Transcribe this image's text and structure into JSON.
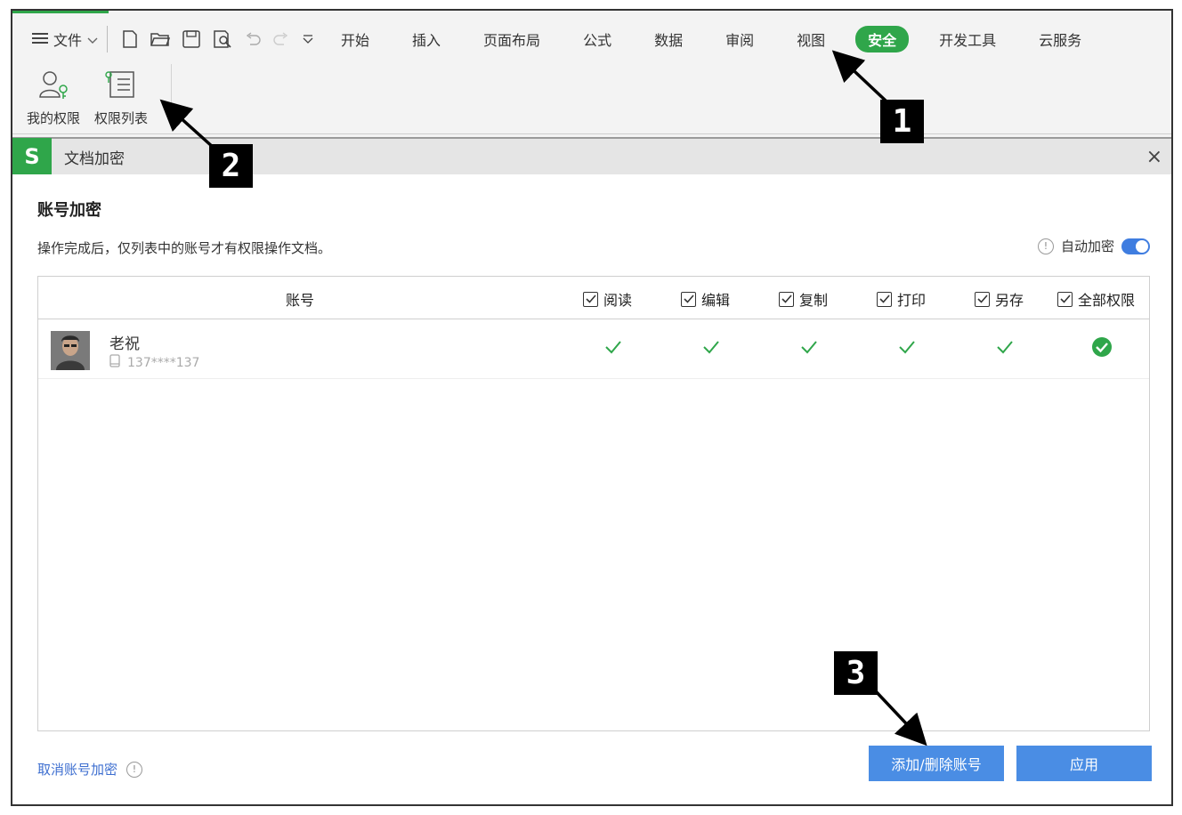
{
  "menu": {
    "file_label": "文件",
    "tabs": [
      {
        "label": "开始",
        "active": false
      },
      {
        "label": "插入",
        "active": false
      },
      {
        "label": "页面布局",
        "active": false
      },
      {
        "label": "公式",
        "active": false
      },
      {
        "label": "数据",
        "active": false
      },
      {
        "label": "审阅",
        "active": false
      },
      {
        "label": "视图",
        "active": false
      },
      {
        "label": "安全",
        "active": true
      },
      {
        "label": "开发工具",
        "active": false
      },
      {
        "label": "云服务",
        "active": false
      }
    ]
  },
  "tools": {
    "my_permission": "我的权限",
    "permission_list": "权限列表"
  },
  "dialog": {
    "logo": "S",
    "title": "文档加密",
    "close": "×",
    "section_title": "账号加密",
    "description": "操作完成后，仅列表中的账号才有权限操作文档。",
    "auto_encrypt_label": "自动加密",
    "auto_encrypt_on": true,
    "table": {
      "account_header": "账号",
      "permission_headers": [
        "阅读",
        "编辑",
        "复制",
        "打印",
        "另存",
        "全部权限"
      ],
      "rows": [
        {
          "name": "老祝",
          "phone": "137****137",
          "permissions": [
            true,
            true,
            true,
            true,
            true,
            true
          ]
        }
      ]
    },
    "cancel_link": "取消账号加密",
    "add_remove_button": "添加/删除账号",
    "apply_button": "应用"
  },
  "markers": [
    "1",
    "2",
    "3"
  ],
  "colors": {
    "accent_green": "#2fa64a",
    "button_blue": "#4a8de4",
    "link_blue": "#3e6fd0"
  }
}
